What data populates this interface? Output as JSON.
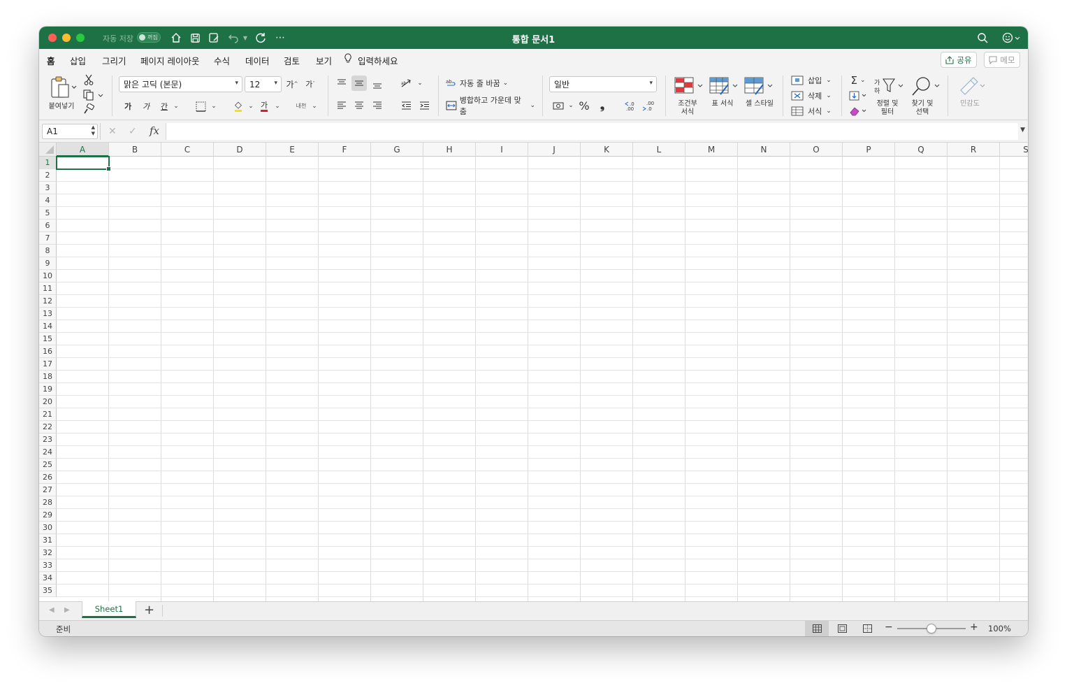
{
  "window": {
    "title": "통합 문서1",
    "autosave_label": "자동 저장",
    "autosave_state": "꺼짐"
  },
  "tabs": [
    {
      "label": "홈",
      "active": true
    },
    {
      "label": "삽입"
    },
    {
      "label": "그리기"
    },
    {
      "label": "페이지 레이아웃"
    },
    {
      "label": "수식"
    },
    {
      "label": "데이터"
    },
    {
      "label": "검토"
    },
    {
      "label": "보기"
    },
    {
      "label": "입력하세요"
    }
  ],
  "share_label": "공유",
  "memo_label": "메모",
  "ribbon": {
    "paste_label": "붙여넣기",
    "font_name": "맑은 고딕 (본문)",
    "font_size": "12",
    "grow_font": "가",
    "shrink_font": "가",
    "bold": "가",
    "italic": "가",
    "underline": "간",
    "font_color_glyph": "가",
    "phonetic": "내천",
    "wrap_text": "자동 줄 바꿈",
    "merge_center": "병합하고 가운데 맞춤",
    "number_format": "일반",
    "percent": "%",
    "comma": "❟",
    "conditional_format": "조건부\n서식",
    "conditional_format_line1": "조건부",
    "conditional_format_line2": "서식",
    "format_as_table": "표 서식",
    "cell_styles": "셀 스타일",
    "insert": "삽입",
    "delete": "삭제",
    "format": "서식",
    "sort_filter_line1": "정렬 및",
    "sort_filter_line2": "필터",
    "find_select_line1": "찾기 및",
    "find_select_line2": "선택",
    "sensitivity": "민감도",
    "accent_color": "#1e7145"
  },
  "formula_bar": {
    "name_box": "A1",
    "fx": "fx",
    "value": ""
  },
  "grid": {
    "columns": [
      "A",
      "B",
      "C",
      "D",
      "E",
      "F",
      "G",
      "H",
      "I",
      "J",
      "K",
      "L",
      "M",
      "N",
      "O",
      "P",
      "Q",
      "R",
      "S"
    ],
    "rows": [
      "1",
      "2",
      "3",
      "4",
      "5",
      "6",
      "7",
      "8",
      "9",
      "10",
      "11",
      "12",
      "13",
      "14",
      "15",
      "16",
      "17",
      "18",
      "19",
      "20",
      "21",
      "22",
      "23",
      "24",
      "25",
      "26",
      "27",
      "28",
      "29",
      "30",
      "31",
      "32",
      "33",
      "34",
      "35"
    ],
    "active_cell": "A1"
  },
  "sheets": [
    {
      "name": "Sheet1",
      "active": true
    }
  ],
  "status": {
    "ready": "준비",
    "zoom": "100%",
    "zoom_percent": 100
  }
}
